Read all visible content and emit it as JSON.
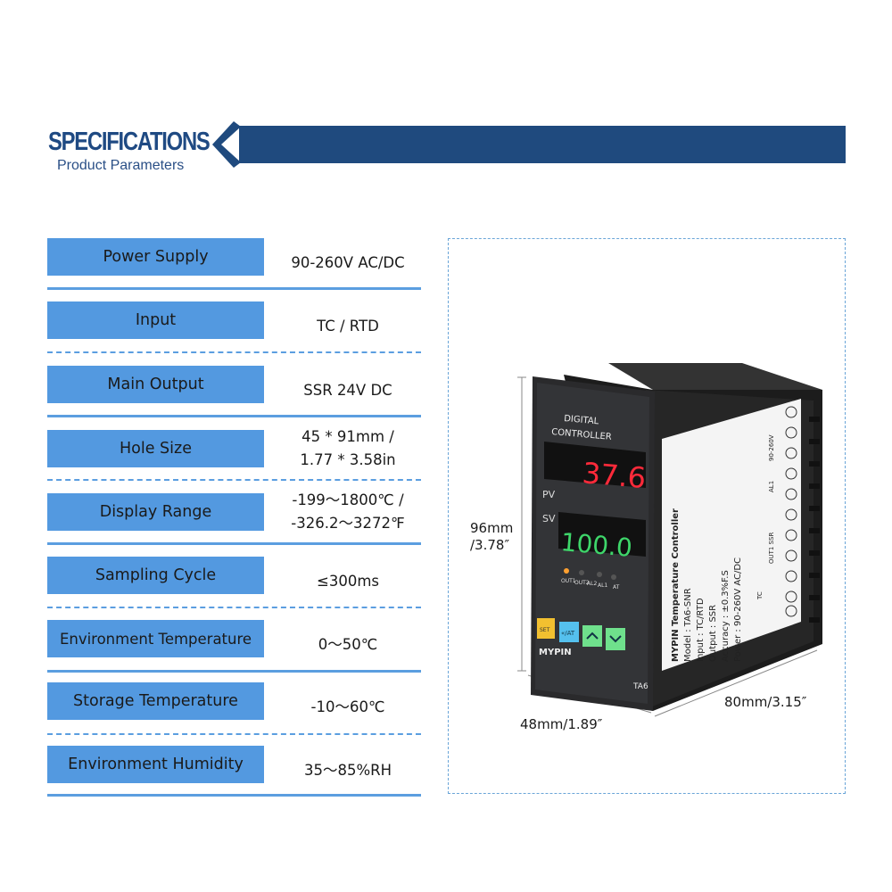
{
  "header": {
    "title": "SPECIFICATIONS",
    "subtitle": "Product Parameters",
    "accent_color": "#1f4a7e"
  },
  "specs": [
    {
      "label": "Power Supply",
      "value": [
        "90-260V AC/DC"
      ]
    },
    {
      "label": "Input",
      "value": [
        "TC / RTD"
      ]
    },
    {
      "label": "Main Output",
      "value": [
        "SSR 24V DC"
      ]
    },
    {
      "label": "Hole Size",
      "value": [
        "45 * 91mm /",
        "1.77 * 3.58in"
      ]
    },
    {
      "label": "Display Range",
      "value": [
        "-199～1800℃ /",
        "-326.2～3272℉"
      ]
    },
    {
      "label": "Sampling Cycle",
      "value": [
        "≤300ms"
      ]
    },
    {
      "label": "Environment Temperature",
      "value": [
        "0～50℃"
      ]
    },
    {
      "label": "Storage Temperature",
      "value": [
        "-10～60℃"
      ]
    },
    {
      "label": "Environment Humidity",
      "value": [
        "35～85%RH"
      ]
    }
  ],
  "label_color": "#5399e0",
  "dimensions": {
    "height": "96mm",
    "height_in": "/3.78″",
    "width": "48mm/1.89″",
    "depth": "80mm/3.15″"
  },
  "device": {
    "front_title_1": "DIGITAL",
    "front_title_2": "CONTROLLER",
    "pv_label": "PV",
    "sv_label": "SV",
    "pv_value": "37.6",
    "sv_value": "100.0",
    "indicators": [
      "OUT1",
      "OUT2",
      "AL2",
      "AL1",
      "AT"
    ],
    "buttons": {
      "set": "SET",
      "shift_at": "«/AT",
      "up": "up-icon",
      "down": "down-icon"
    },
    "brand": "MYPIN",
    "model_short": "TA6",
    "side_label": {
      "title": "MYPIN Temperature Controller",
      "model": "Model : TA6-SNR",
      "input": "Input : TC/RTD",
      "output": "Output : SSR",
      "accuracy": "Accuracy : ±0.3%F.S",
      "power": "Power : 90-260V AC/DC",
      "wiring_power": "90-260V",
      "wiring_al1": "AL1",
      "wiring_out1": "OUT1 SSR",
      "wiring_tc": "TC"
    }
  }
}
